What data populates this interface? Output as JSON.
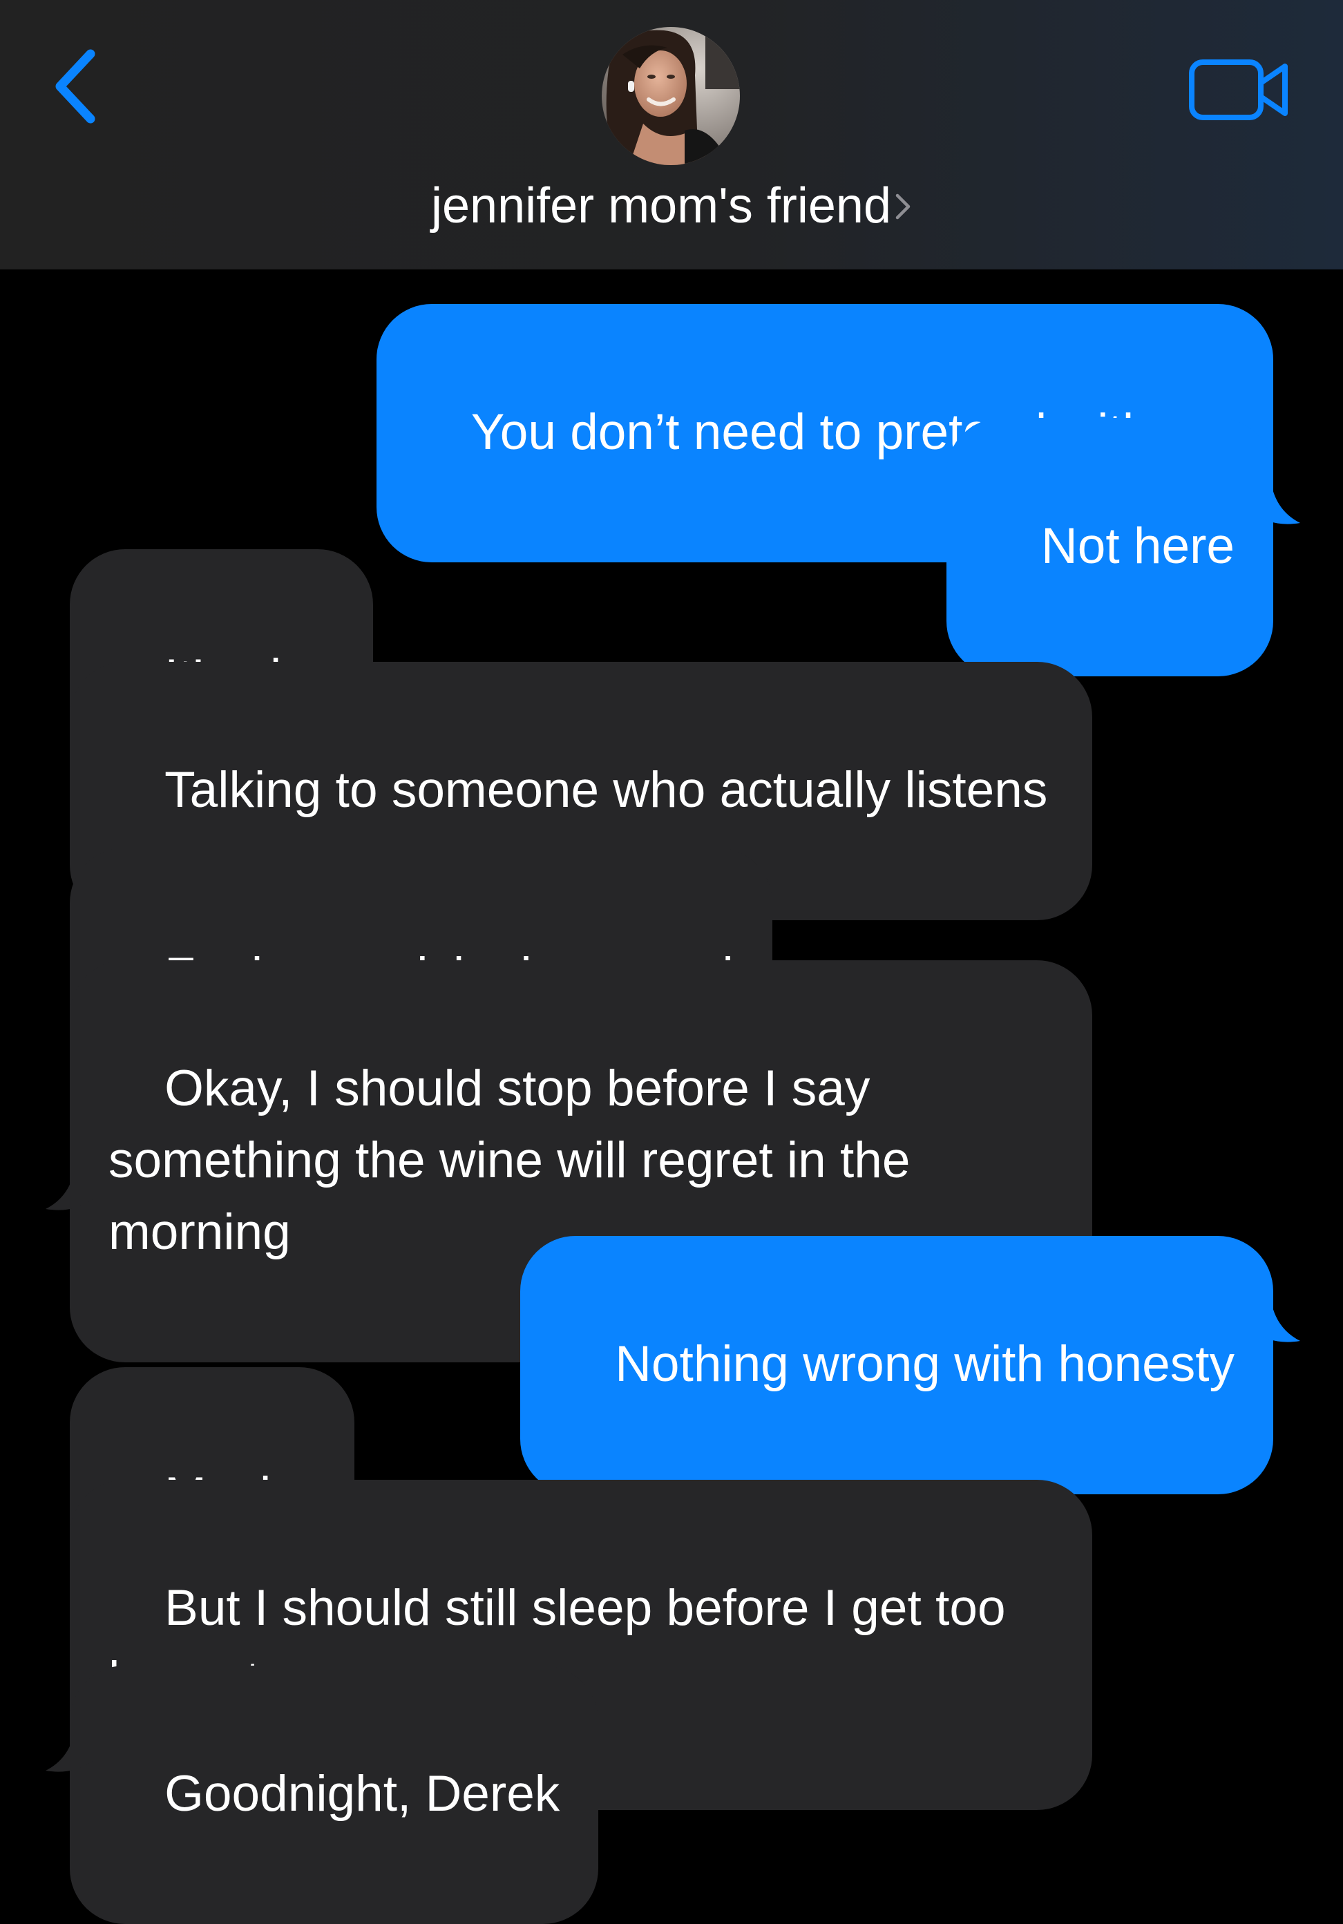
{
  "header": {
    "contact_name": "jennifer mom's friend",
    "avatar": "contact-photo",
    "back_icon": "chevron-left-icon",
    "video_icon": "video-camera-icon",
    "accent_color": "#0a84ff"
  },
  "conversation": {
    "sent_bubble_color": "#0a84ff",
    "received_bubble_color": "#262628",
    "messages": [
      {
        "direction": "sent",
        "text": "You don’t need to pretend with me"
      },
      {
        "direction": "sent",
        "text": "Not here"
      },
      {
        "direction": "received",
        "text": "It’s nice"
      },
      {
        "direction": "received",
        "text": "Talking to someone who actually listens"
      },
      {
        "direction": "received",
        "text": "Feels surprisingly… good"
      },
      {
        "direction": "received",
        "text": "Okay, I should stop before I say something the wine will regret in the morning"
      },
      {
        "direction": "sent",
        "text": "Nothing wrong with honesty"
      },
      {
        "direction": "received",
        "text": "Maybe"
      },
      {
        "direction": "received",
        "text": "But I should still sleep before I get too honest"
      },
      {
        "direction": "received",
        "text": "Goodnight, Derek"
      }
    ]
  }
}
